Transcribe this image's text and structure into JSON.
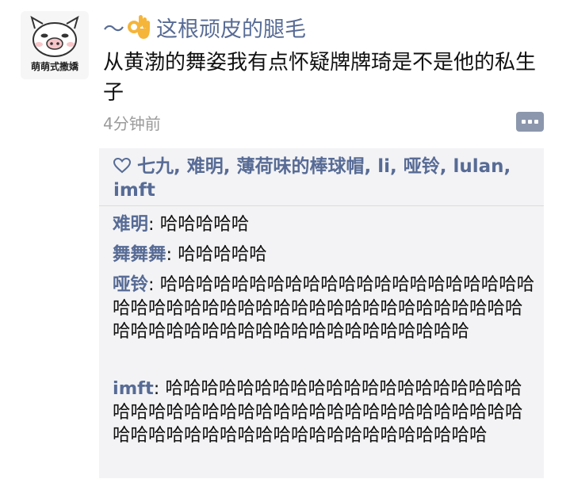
{
  "avatar": {
    "caption": "萌萌式撒嬌",
    "icon": "pig-face-icon"
  },
  "post": {
    "author": "～👌这根顽皮的腿毛",
    "author_prefix": "～",
    "author_emoji": "ok-hand-icon",
    "author_name": "这根顽皮的腿毛",
    "text": "从黄渤的舞姿我有点怀疑牌牌琦是不是他的私生子",
    "time": "4分钟前"
  },
  "likes": {
    "icon": "heart-outline-icon",
    "text": "七九, 难明, 薄荷味的棒球帽, li, 哑铃, lulan, imft"
  },
  "comments": [
    {
      "name": "难明",
      "sep": ": ",
      "text": "哈哈哈哈哈"
    },
    {
      "name": "舞舞舞",
      "sep": ": ",
      "text": "哈哈哈哈哈"
    },
    {
      "name": "哑铃",
      "sep": ": ",
      "text": "哈哈哈哈哈哈哈哈哈哈哈哈哈哈哈哈哈哈哈哈哈哈哈哈哈哈哈哈哈哈哈哈哈哈哈哈哈哈哈哈哈哈哈哈哈哈哈哈哈哈哈哈哈哈哈哈哈哈哈哈哈哈哈哈"
    },
    {
      "name": "imft",
      "sep": ": ",
      "text": "哈哈哈哈哈哈哈哈哈哈哈哈哈哈哈哈哈哈哈哈哈哈哈哈哈哈哈哈哈哈哈哈哈哈哈哈哈哈哈哈哈哈哈哈哈哈哈哈哈哈哈哈哈哈哈哈哈哈哈哈哈哈哈哈"
    }
  ],
  "colors": {
    "link": "#576b95",
    "panel": "#f3f3f5",
    "meta": "#9b9b9b"
  }
}
